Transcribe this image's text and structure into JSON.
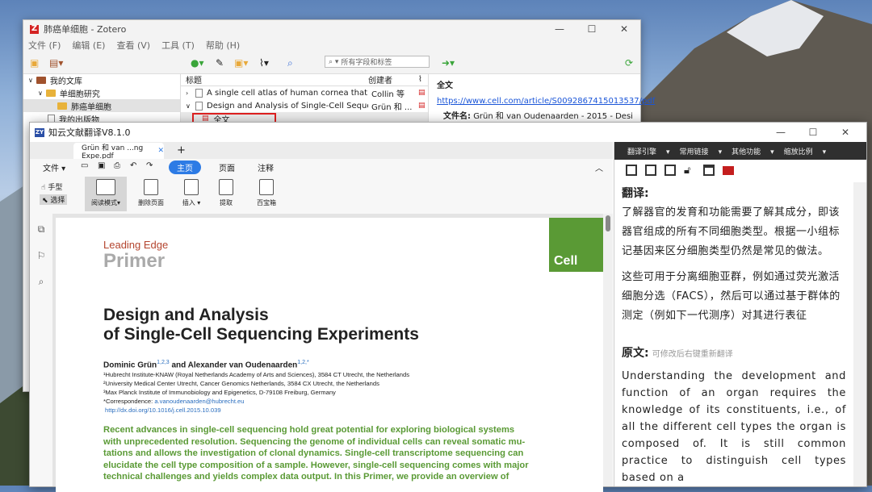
{
  "zotero": {
    "title": "肺癌单细胞 - Zotero",
    "menu": [
      "文件 (F)",
      "编辑 (E)",
      "查看 (V)",
      "工具 (T)",
      "帮助 (H)"
    ],
    "search_placeholder": "所有字段和标签",
    "tree": [
      {
        "label": "我的文库"
      },
      {
        "label": "单细胞研究"
      },
      {
        "label": "肺癌单细胞"
      },
      {
        "label": "我的出版物"
      }
    ],
    "columns": {
      "title": "标题",
      "creator": "创建者"
    },
    "items": [
      {
        "title": "A single cell atlas of human cornea that d...",
        "creator": "Collin 等"
      },
      {
        "title": "Design and Analysis of Single-Cell Seque...",
        "creator": "Grün 和 ..."
      },
      {
        "title": "全文",
        "creator": ""
      }
    ],
    "right": {
      "header": "全文",
      "url": "https://www.cell.com/article/S0092867415013537/pdf",
      "filename_label": "文件名:",
      "filename": "Grün 和 van Oudenaarden - 2015 - Design ..."
    }
  },
  "translator": {
    "title": "知云文献翻译V8.1.0",
    "tab": "Grün 和 van ...ng Expe.pdf",
    "ribbon": {
      "file": "文件",
      "tabs": [
        "主页",
        "页面",
        "注释"
      ],
      "hand": "手型",
      "select": "选择",
      "tools": [
        "阅读模式",
        "删除页面",
        "插入",
        "提取",
        "百宝箱"
      ]
    },
    "panel_toolbar": [
      "翻译引擎",
      "常用链接",
      "其他功能",
      "缩放比例"
    ],
    "translation_heading": "翻译:",
    "translation": [
      "了解器官的发育和功能需要了解其成分，即该器官组成的所有不同细胞类型。根据一小组标记基因来区分细胞类型仍然是常见的做法。",
      "这些可用于分离细胞亚群，例如通过荧光激活细胞分选（FACS），然后可以通过基于群体的测定（例如下一代测序）对其进行表征"
    ],
    "original_heading": "原文:",
    "original_hint": "可修改后右键重新翻译",
    "original": "Understanding the development and function of an organ requires the knowledge of its constituents, i.e., of all the different cell types the organ is composed of. It is still common practice to distinguish cell types based on a"
  },
  "paper": {
    "section": "Leading Edge",
    "type": "Primer",
    "journal": "Cell",
    "title_line1": "Design and Analysis",
    "title_line2": "of Single-Cell Sequencing Experiments",
    "authors_a": "Dominic Grün",
    "authors_a_sup": "1,2,3",
    "authors_mid": " and Alexander van Oudenaarden",
    "authors_b_sup": "1,2,*",
    "affiliations": [
      "¹Hubrecht Institute-KNAW (Royal Netherlands Academy of Arts and Sciences), 3584 CT Utrecht, the Netherlands",
      "²University Medical Center Utrecht, Cancer Genomics Netherlands, 3584 CX Utrecht, the Netherlands",
      "³Max Planck Institute of Immunobiology and Epigenetics, D-79108 Freiburg, Germany"
    ],
    "correspondence_label": "*Correspondence: ",
    "correspondence_email": "a.vanoudenaarden@hubrecht.eu",
    "doi": "http://dx.doi.org/10.1016/j.cell.2015.10.039",
    "abstract": [
      "Recent advances in single-cell sequencing hold great potential for exploring biological systems",
      "with unprecedented resolution. Sequencing the genome of individual cells can reveal somatic mu-",
      "tations and allows the investigation of clonal dynamics. Single-cell transcriptome sequencing can",
      "elucidate the cell type composition of a sample. However, single-cell sequencing comes with major",
      "technical challenges and yields complex data output. In this Primer, we provide an overview of"
    ]
  }
}
